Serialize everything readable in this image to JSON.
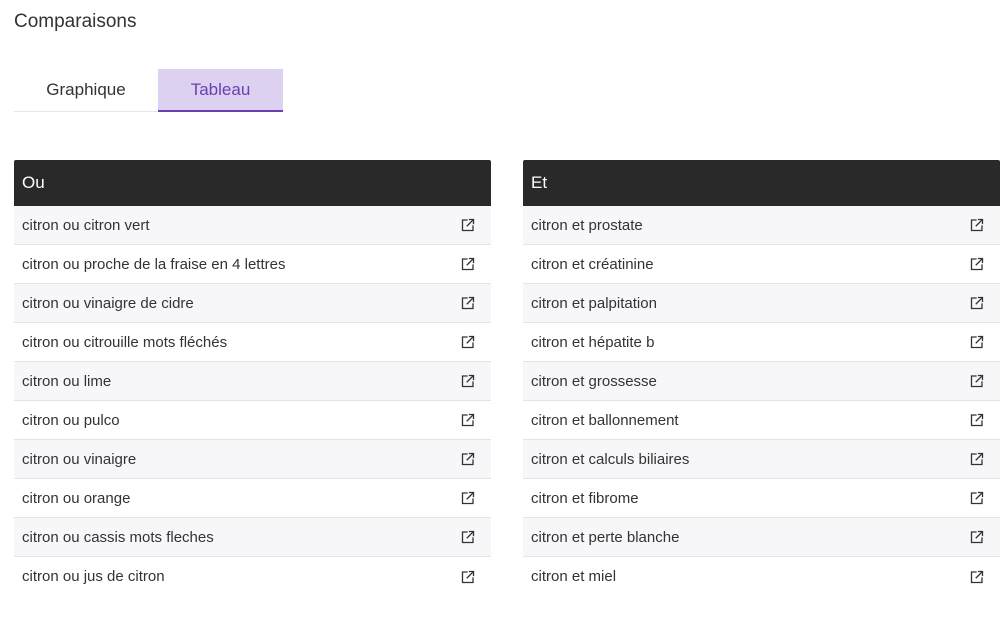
{
  "section": {
    "title": "Comparaisons"
  },
  "tabs": [
    {
      "label": "Graphique",
      "active": false
    },
    {
      "label": "Tableau",
      "active": true
    }
  ],
  "tables": {
    "left": {
      "header": "Ou",
      "rows": [
        "citron ou citron vert",
        "citron ou proche de la fraise en 4 lettres",
        "citron ou vinaigre de cidre",
        "citron ou citrouille mots fléchés",
        "citron ou lime",
        "citron ou pulco",
        "citron ou vinaigre",
        "citron ou orange",
        "citron ou cassis mots fleches",
        "citron ou jus de citron"
      ]
    },
    "right": {
      "header": "Et",
      "rows": [
        "citron et prostate",
        "citron et créatinine",
        "citron et palpitation",
        "citron et hépatite b",
        "citron et grossesse",
        "citron et ballonnement",
        "citron et calculs biliaires",
        "citron et fibrome",
        "citron et perte blanche",
        "citron et miel"
      ]
    }
  },
  "icons": {
    "row_action": "external-link-icon"
  },
  "colors": {
    "accent": "#6a3fb0",
    "active_tab_bg": "#ddd1f1",
    "table_header_bg": "#292929"
  }
}
